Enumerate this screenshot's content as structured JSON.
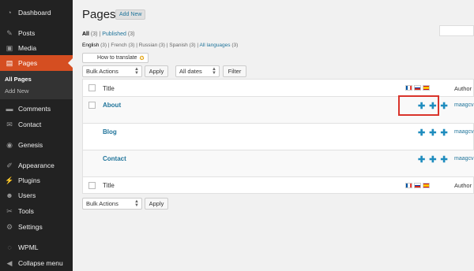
{
  "sidebar": {
    "items": [
      {
        "label": "Dashboard",
        "icon": "dashboard-icon",
        "glyph": "◔"
      },
      {
        "label": "Posts",
        "icon": "pin-icon",
        "glyph": "✎"
      },
      {
        "label": "Media",
        "icon": "media-icon",
        "glyph": "▣"
      },
      {
        "label": "Pages",
        "icon": "pages-icon",
        "glyph": "▤"
      },
      {
        "label": "Comments",
        "icon": "comments-icon",
        "glyph": "▬"
      },
      {
        "label": "Contact",
        "icon": "contact-icon",
        "glyph": "✉"
      },
      {
        "label": "Genesis",
        "icon": "genesis-icon",
        "glyph": "◉"
      },
      {
        "label": "Appearance",
        "icon": "appearance-icon",
        "glyph": "✐"
      },
      {
        "label": "Plugins",
        "icon": "plugins-icon",
        "glyph": "⚡"
      },
      {
        "label": "Users",
        "icon": "users-icon",
        "glyph": "☻"
      },
      {
        "label": "Tools",
        "icon": "tools-icon",
        "glyph": "✂"
      },
      {
        "label": "Settings",
        "icon": "settings-icon",
        "glyph": "⚙"
      },
      {
        "label": "WPML",
        "icon": "wpml-icon",
        "glyph": "◌"
      },
      {
        "label": "Collapse menu",
        "icon": "collapse-icon",
        "glyph": "◀"
      }
    ],
    "submenu": [
      "All Pages",
      "Add New"
    ]
  },
  "header": {
    "title": "Pages",
    "add_new": "Add New"
  },
  "views": {
    "all": "All",
    "all_count": "(3)",
    "sep": "|",
    "published": "Published",
    "published_count": "(3)"
  },
  "langs": {
    "english": "English",
    "english_count": "(3)",
    "french": "French",
    "french_count": "(3)",
    "russian": "Russian",
    "russian_count": "(3)",
    "spanish": "Spanish",
    "spanish_count": "(3)",
    "all": "All languages",
    "all_count": "(3)"
  },
  "translate_button": "How to translate",
  "filters": {
    "bulk_actions": "Bulk Actions",
    "apply": "Apply",
    "dates": "All dates",
    "filter": "Filter"
  },
  "table": {
    "header_title": "Title",
    "header_author": "Author",
    "rows": [
      {
        "title": "About",
        "author": "maagcv"
      },
      {
        "title": "Blog",
        "author": "maagcv"
      },
      {
        "title": "Contact",
        "author": "maagcv"
      }
    ],
    "plus_glyph": "✚"
  },
  "colors": {
    "accent": "#d54e21",
    "link": "#21759b",
    "highlight": "#d9342b"
  }
}
